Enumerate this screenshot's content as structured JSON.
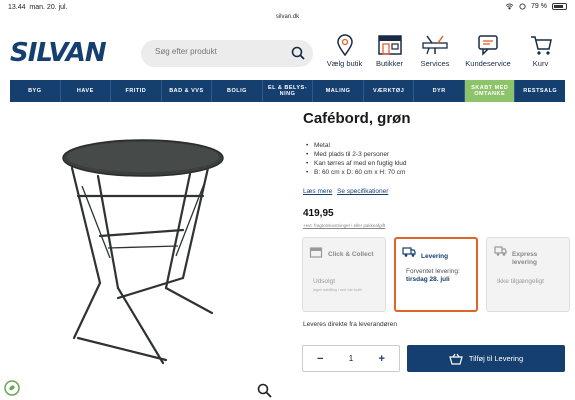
{
  "status": {
    "time": "13.44",
    "date": "man. 20. jul.",
    "url": "silvan.dk",
    "battery": "79 %"
  },
  "header": {
    "logo": "SILVAN",
    "search_placeholder": "Søg efter produkt",
    "nav": [
      {
        "label": "Vælg butik",
        "icon": "map-pin-icon"
      },
      {
        "label": "Butikker",
        "icon": "store-icon"
      },
      {
        "label": "Services",
        "icon": "tools-icon"
      },
      {
        "label": "Kundeservice",
        "icon": "chat-icon"
      },
      {
        "label": "Kurv",
        "icon": "cart-icon"
      }
    ]
  },
  "menu": [
    "BYG",
    "HAVE",
    "FRITID",
    "BAD & VVS",
    "BOLIG",
    "EL & BELYS-NING",
    "MALING",
    "VÆRKTØJ",
    "DYR",
    "SKABT MED OMTANKE",
    "RESTSALG"
  ],
  "product": {
    "title": "Cafébord, grøn",
    "features": [
      "Metal",
      "Med plads til 2-3 personer",
      "Kan tørres af med en fugtig klud",
      "B: 60 cm x D: 60 cm x H: 70 cm"
    ],
    "read_more": "Læs mere",
    "specs": "Se specifikationer",
    "price": "419,95",
    "fineprint": "+evt. fragtomkostninger i eller pakkeafgift"
  },
  "delivery": {
    "click_collect": {
      "title": "Click & Collect",
      "sub": "Udsolgt",
      "note": "Ingen udstilling i ned i din butik"
    },
    "levering": {
      "title": "Levering",
      "sub_prefix": "Forventet levering: ",
      "sub_bold": "tirsdag 28. juli"
    },
    "express": {
      "title": "Express levering",
      "sub": "Ikke tilgængeligt"
    }
  },
  "direct_text": "Leveres direkte fra leverandøren",
  "quantity": {
    "minus": "−",
    "value": "1",
    "plus": "+"
  },
  "add_to_cart": "Tilføj til Levering",
  "colors": {
    "brand": "#143f6f",
    "accent": "#e0632a",
    "green": "#8cc36b"
  }
}
